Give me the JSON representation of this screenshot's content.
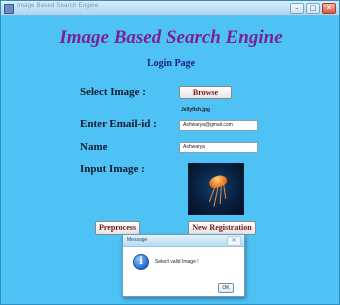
{
  "window": {
    "title": "Image Based Search Engine",
    "controls": {
      "minimize": "–",
      "maximize": "□",
      "close": "✕"
    }
  },
  "app_title": "Image Based Search Engine",
  "page_heading": "Login Page",
  "form": {
    "select_image_label": "Select Image :",
    "browse_label": "Browse",
    "file_name": "Jellyfish.jpg",
    "email_label": "Enter Email-id :",
    "email_value": "Ashwarya@gmail.com",
    "name_label": "Name",
    "name_value": "Ashwarya",
    "input_image_label": "Input Image :"
  },
  "buttons": {
    "preprocess": "Preprocess",
    "new_registration": "New Registration"
  },
  "dialog": {
    "title": "Message",
    "close": "✕",
    "icon": "info-icon",
    "icon_glyph": "i",
    "message": "Select valid Image !",
    "ok_label": "OK"
  },
  "colors": {
    "background": "#4fc2f5",
    "app_title": "#7b2198",
    "heading": "#1b1e87",
    "button_text": "#7a1414"
  }
}
